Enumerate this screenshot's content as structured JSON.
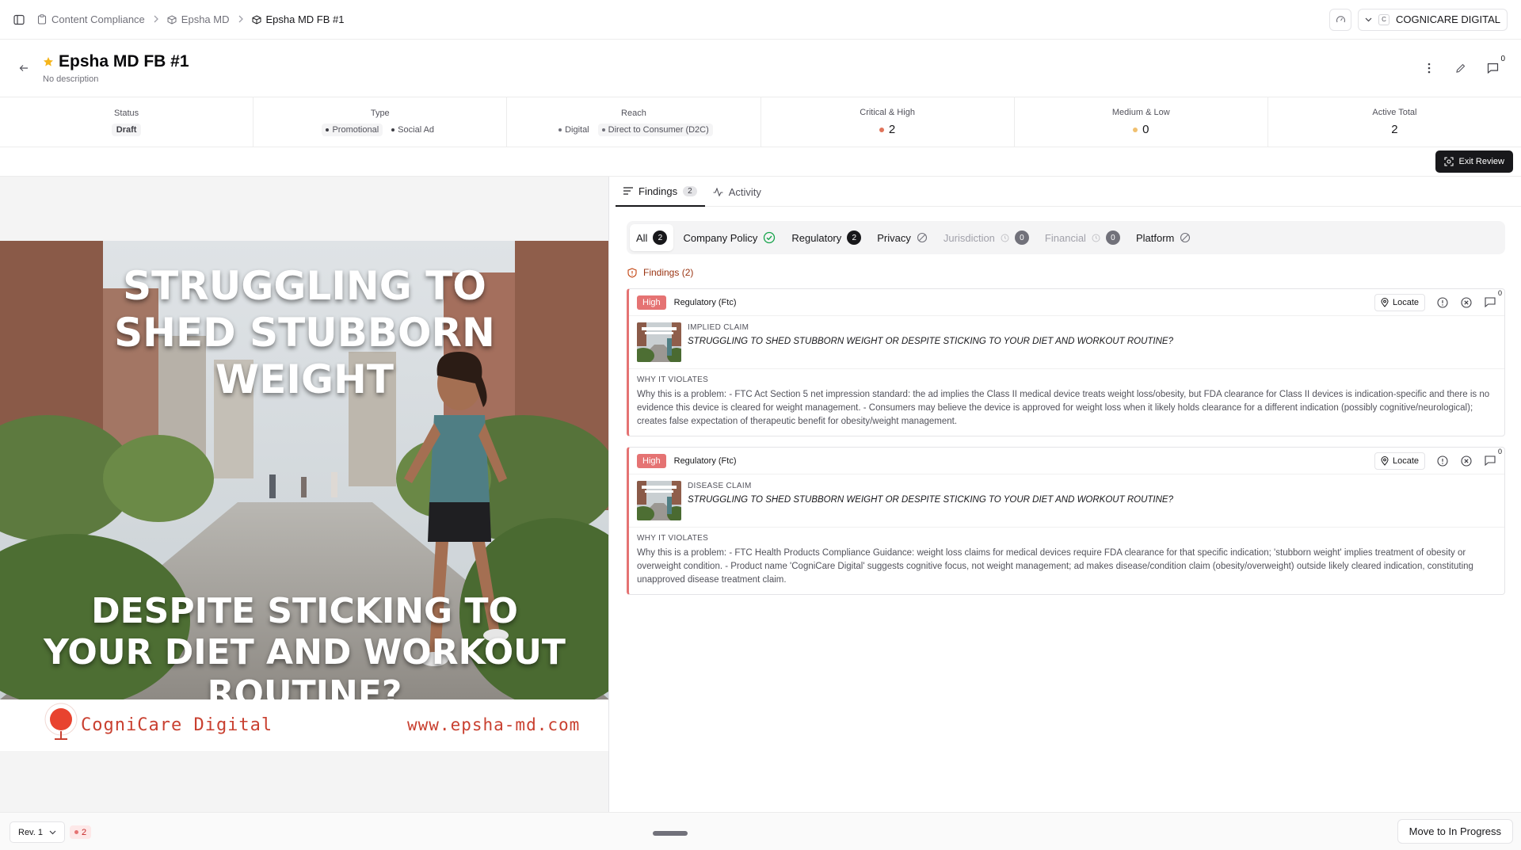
{
  "breadcrumb": {
    "items": [
      {
        "label": "Content Compliance",
        "icon": "clipboard-icon"
      },
      {
        "label": "Epsha MD",
        "icon": "box-icon"
      },
      {
        "label": "Epsha MD FB #1",
        "icon": "box-icon"
      }
    ]
  },
  "topbar": {
    "org_badge": "C",
    "org_name": "COGNICARE DIGITAL"
  },
  "header": {
    "title": "Epsha MD FB #1",
    "description": "No description",
    "comment_count": "0"
  },
  "stats": {
    "status": {
      "label": "Status",
      "value": "Draft"
    },
    "type": {
      "label": "Type",
      "values": [
        "Promotional",
        "Social Ad"
      ]
    },
    "reach": {
      "label": "Reach",
      "values": [
        "Digital",
        "Direct to Consumer (D2C)"
      ]
    },
    "critical_high": {
      "label": "Critical & High",
      "value": "2"
    },
    "medium_low": {
      "label": "Medium & Low",
      "value": "0"
    },
    "active_total": {
      "label": "Active Total",
      "value": "2"
    }
  },
  "subbar": {
    "exit_review": "Exit Review"
  },
  "ad": {
    "headline_top": "STRUGGLING TO SHED STUBBORN WEIGHT",
    "headline_bottom": "DESPITE STICKING TO YOUR DIET AND WORKOUT ROUTINE?",
    "brand_name": "CogniCare Digital",
    "brand_url": "www.epsha-md.com"
  },
  "tabs": {
    "findings": {
      "label": "Findings",
      "count": "2"
    },
    "activity": {
      "label": "Activity"
    }
  },
  "filters": {
    "all": {
      "label": "All",
      "count": "2"
    },
    "company_policy": {
      "label": "Company Policy"
    },
    "regulatory": {
      "label": "Regulatory",
      "count": "2"
    },
    "privacy": {
      "label": "Privacy"
    },
    "jurisdiction": {
      "label": "Jurisdiction",
      "count": "0"
    },
    "financial": {
      "label": "Financial",
      "count": "0"
    },
    "platform": {
      "label": "Platform"
    }
  },
  "findings_heading": "Findings (2)",
  "findings": [
    {
      "severity": "High",
      "category": "Regulatory (Ftc)",
      "locate": "Locate",
      "comments": "0",
      "claim_type": "IMPLIED CLAIM",
      "claim_text": "STRUGGLING TO SHED STUBBORN WEIGHT OR DESPITE STICKING TO YOUR DIET AND WORKOUT ROUTINE?",
      "why_label": "WHY IT VIOLATES",
      "why_text": "Why this is a problem: - FTC Act Section 5 net impression standard: the ad implies the Class II medical device treats weight loss/obesity, but FDA clearance for Class II devices is indication-specific and there is no evidence this device is cleared for weight management. - Consumers may believe the device is approved for weight loss when it likely holds clearance for a different indication (possibly cognitive/neurological); creates false expectation of therapeutic benefit for obesity/weight management."
    },
    {
      "severity": "High",
      "category": "Regulatory (Ftc)",
      "locate": "Locate",
      "comments": "0",
      "claim_type": "DISEASE CLAIM",
      "claim_text": "STRUGGLING TO SHED STUBBORN WEIGHT OR DESPITE STICKING TO YOUR DIET AND WORKOUT ROUTINE?",
      "why_label": "WHY IT VIOLATES",
      "why_text": "Why this is a problem: - FTC Health Products Compliance Guidance: weight loss claims for medical devices require FDA clearance for that specific indication; 'stubborn weight' implies treatment of obesity or overweight condition. - Product name 'CogniCare Digital' suggests cognitive focus, not weight management; ad makes disease/condition claim (obesity/overweight) outside likely cleared indication, constituting unapproved disease treatment claim."
    }
  ],
  "bottombar": {
    "revision": "Rev. 1",
    "issue_count": "2",
    "move_button": "Move to In Progress"
  },
  "colors": {
    "severity_high": "#e57373",
    "critical_dot": "#e0735a",
    "medium_dot": "#f0c070",
    "primary": "#18181b"
  }
}
